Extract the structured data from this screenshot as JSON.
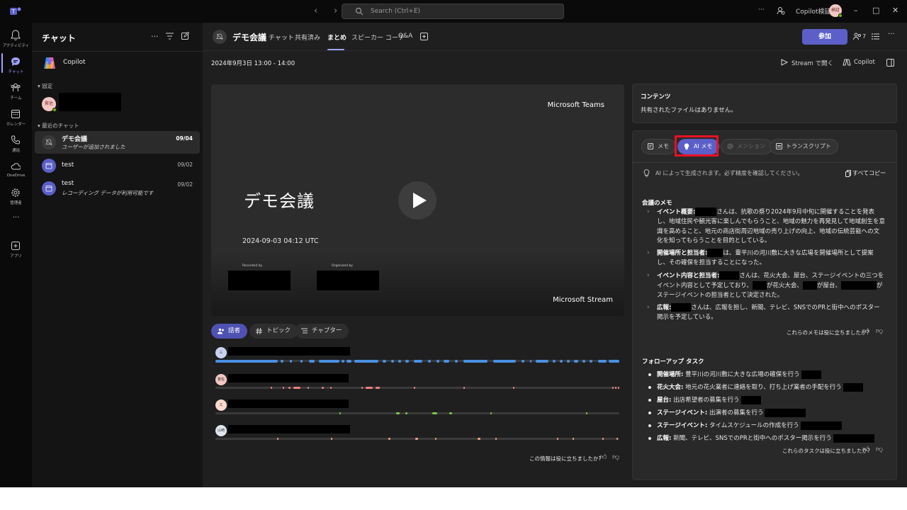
{
  "titlebar": {
    "search_placeholder": "Search (Ctrl+E)",
    "more": "···",
    "account": "Copilot検証",
    "avatar_initials": "検証",
    "back": "‹",
    "forward": "›"
  },
  "rail": {
    "activity": "アクティビティ",
    "chat": "チャット",
    "teams": "チーム",
    "calendar": "カレンダー",
    "calls": "通話",
    "onedrive": "OneDrive",
    "admin": "管理者",
    "more": "···",
    "apps": "アプリ"
  },
  "chatlist": {
    "title": "チャット",
    "copilot": "Copilot",
    "pinned_header": "固定",
    "recent_header": "最近のチャット",
    "pinned_avatar": "繁佐",
    "items": [
      {
        "name": "デモ会議",
        "sub": "ユーザーが追加されました",
        "date": "09/04"
      },
      {
        "name": "test",
        "sub": "",
        "date": "09/02"
      },
      {
        "name": "test",
        "sub": "レコーディング データが利用可能です",
        "date": "09/02"
      }
    ]
  },
  "header": {
    "title": "デモ会議",
    "tabs": [
      "チャット",
      "共有済み",
      "まとめ",
      "スピーカー コーチ",
      "Q&A"
    ],
    "active_tab": "まとめ",
    "join": "参加",
    "participants": "7"
  },
  "subheader": {
    "date": "2024年9月3日 13:00 - 14:00",
    "open_stream": "Stream で開く",
    "copilot": "Copilot"
  },
  "video": {
    "brand": "Microsoft Teams",
    "title": "デモ会議",
    "date": "2024-09-03 04:12 UTC",
    "recorded_by": "Recorded by",
    "organized_by": "Organized by",
    "stream": "Microsoft Stream"
  },
  "pills": [
    "話者",
    "トピック",
    "チャプター"
  ],
  "speakers": [
    {
      "initial": "三",
      "color": "#4a90e2"
    },
    {
      "initial": "繁佐",
      "color": "#f08080"
    },
    {
      "initial": "工",
      "color": "#7ac943"
    },
    {
      "initial": "山崎",
      "color": "#f4a582"
    }
  ],
  "left_feedback": "この情報は役に立ちましたか?",
  "content_card": {
    "heading": "コンテンツ",
    "text": "共有されたファイルはありません。"
  },
  "notes_tabs": [
    "メモ",
    "AI メモ",
    "メンション",
    "トランスクリプト"
  ],
  "ai_notice": "AI によって生成されます。必ず精度を確認してください。",
  "copy_all": "すべてコピー",
  "meeting_notes": {
    "heading": "会議のメモ",
    "items": [
      {
        "label": "イベント概要:",
        "l1a": "",
        "l1b": "さんは、抗歌の祭り2024年9月中旬に開催することを発表し、地域",
        "rest": "住民や観光客に楽しんでもらうこと、地域の魅力を再発見して地域創生を意識を高めること、地元の商店街周辺地域の売り上げの向上、地域の伝統芸能への文化を知ってもらうことを目的としている。"
      },
      {
        "label": "開催場所と担当者:",
        "l1b": "は、豊平川の河川敷に大きな広場を開催場所として提案し、",
        "rest": "その確保を担当することになった。"
      },
      {
        "label": "イベント内容と担当者:",
        "l1b": "さんは、花火大会、屋台、ステージイベントの三つをイベ",
        "rest1a": "ント内容として予定しており、",
        "rest1b": "が花火大会、",
        "rest1c": "が屋台、",
        "rest1d": "がステージイベ",
        "rest2": "ントの担当者として決定された。"
      },
      {
        "label": "広報:",
        "l1b": "さんは、広報を担し、新聞、テレビ、SNSでのPRと街中へのポスター掲示",
        "rest": "を予定している。"
      }
    ],
    "feedback": "これらのメモは役に立ちましたか?"
  },
  "tasks": {
    "heading": "フォローアップ タスク",
    "items": [
      {
        "label": "開催場所:",
        "text": "豊平川の河川敷に大きな広場の確保を行う"
      },
      {
        "label": "花火大会:",
        "text": "地元の花火業者に連絡を取り、打ち上げ業者の手配を行う"
      },
      {
        "label": "屋台:",
        "text": "出店希望者の募集を行う"
      },
      {
        "label": "ステージイベント:",
        "text": "出演者の募集を行う"
      },
      {
        "label": "ステージイベント:",
        "text": "タイムスケジュールの作成を行う"
      },
      {
        "label": "広報:",
        "text": "新聞、テレビ、SNSでのPRと街中へのポスター掲示を行う"
      }
    ],
    "feedback": "これらのタスクは役に立ちましたか?"
  },
  "colors": {
    "accent": "#5b5fc7",
    "highlight": "#e81123",
    "rail_active": "#9ea2ff"
  }
}
